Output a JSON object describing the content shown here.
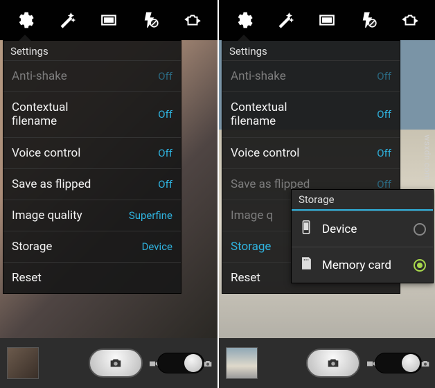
{
  "watermark": "wsxdn.com",
  "left": {
    "panel_title": "Settings",
    "rows": {
      "anti_shake": {
        "label": "Anti-shake",
        "value": "Off"
      },
      "contextual_filename": {
        "label": "Contextual filename",
        "value": "Off"
      },
      "voice_control": {
        "label": "Voice control",
        "value": "Off"
      },
      "save_as_flipped": {
        "label": "Save as flipped",
        "value": "Off"
      },
      "image_quality": {
        "label": "Image quality",
        "value": "Superfine"
      },
      "storage": {
        "label": "Storage",
        "value": "Device"
      },
      "reset": {
        "label": "Reset"
      }
    }
  },
  "right": {
    "panel_title": "Settings",
    "rows": {
      "anti_shake": {
        "label": "Anti-shake",
        "value": "Off"
      },
      "contextual_filename": {
        "label": "Contextual filename",
        "value": "Off"
      },
      "voice_control": {
        "label": "Voice control",
        "value": "Off"
      },
      "save_as_flipped": {
        "label": "Save as flipped",
        "value": "Off"
      },
      "image_quality": {
        "label": "Image q",
        "value": ""
      },
      "storage": {
        "label": "Storage"
      },
      "reset": {
        "label": "Reset"
      }
    },
    "popup": {
      "title": "Storage",
      "options": {
        "device": {
          "label": "Device",
          "selected": false
        },
        "memory_card": {
          "label": "Memory card",
          "selected": true
        }
      }
    }
  }
}
